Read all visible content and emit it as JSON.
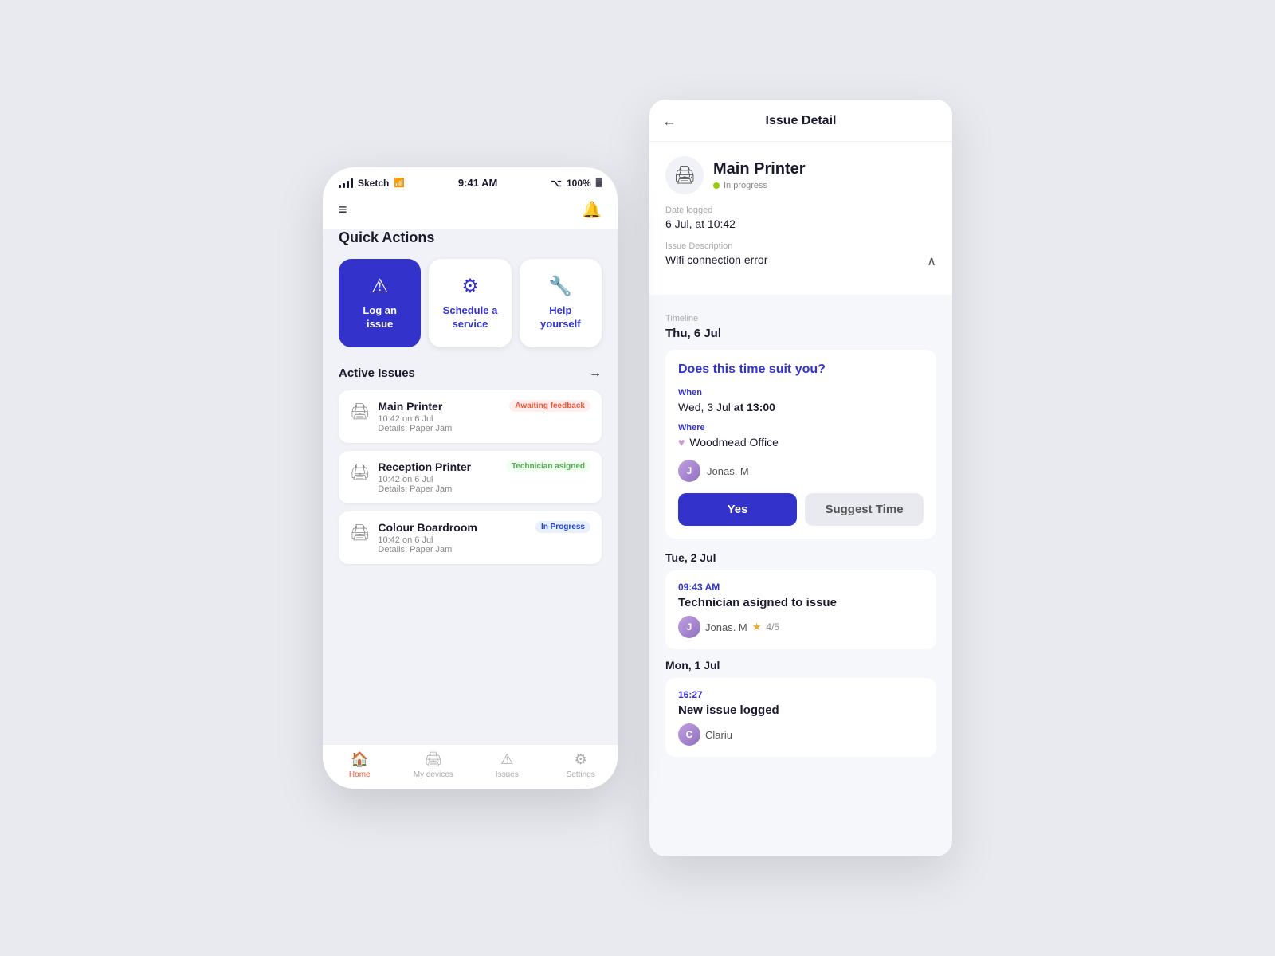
{
  "phone": {
    "status": {
      "carrier": "Sketch",
      "time": "9:41 AM",
      "battery": "100%"
    },
    "header": {
      "menu_icon": "☰",
      "bell_icon": "🔔"
    },
    "quick_actions": {
      "title": "Quick Actions",
      "items": [
        {
          "id": "log",
          "label": "Log an issue",
          "icon": "⚠",
          "type": "primary"
        },
        {
          "id": "schedule",
          "label": "Schedule a service",
          "icon": "⚙",
          "type": "secondary"
        },
        {
          "id": "help",
          "label": "Help yourself",
          "icon": "🔧",
          "type": "secondary"
        }
      ]
    },
    "active_issues": {
      "title": "Active Issues",
      "arrow": "→",
      "items": [
        {
          "name": "Main Printer",
          "time": "10:42 on 6 Jul",
          "details": "Details: Paper Jam",
          "badge": "Awaiting feedback",
          "badge_type": "red",
          "icon": "🖨"
        },
        {
          "name": "Reception Printer",
          "time": "10:42 on 6 Jul",
          "details": "Details: Paper Jam",
          "badge": "Technician asigned",
          "badge_type": "green",
          "icon": "🖨"
        },
        {
          "name": "Colour Boardroom",
          "time": "10:42 on 6 Jul",
          "details": "Details: Paper Jam",
          "badge": "In Progress",
          "badge_type": "blue",
          "icon": "🖨"
        }
      ]
    },
    "nav": {
      "items": [
        {
          "id": "home",
          "label": "Home",
          "icon": "🏠",
          "active": true
        },
        {
          "id": "devices",
          "label": "My devices",
          "icon": "🖨",
          "active": false
        },
        {
          "id": "issues",
          "label": "Issues",
          "icon": "⚠",
          "active": false
        },
        {
          "id": "settings",
          "label": "Settings",
          "icon": "⚙",
          "active": false
        }
      ]
    }
  },
  "detail": {
    "header": {
      "back_icon": "←",
      "title": "Issue Detail"
    },
    "device": {
      "name": "Main Printer",
      "status": "In progress",
      "icon": "🖨"
    },
    "date_logged": {
      "label": "Date logged",
      "value": "6 Jul, at 10:42"
    },
    "description": {
      "label": "Issue Description",
      "value": "Wifi connection error"
    },
    "timeline": {
      "label": "Timeline",
      "sections": [
        {
          "date": "Thu, 6 Jul",
          "events": [
            {
              "type": "time_suit",
              "question": "Does this time suit you?",
              "when_label": "When",
              "when_value_pre": "Wed, 3 Jul",
              "when_value_post": "at 13:00",
              "where_label": "Where",
              "where_value": "Woodmead Office",
              "assignee": "Jonas. M",
              "btn_yes": "Yes",
              "btn_suggest": "Suggest Time"
            }
          ]
        },
        {
          "date": "Tue, 2 Jul",
          "events": [
            {
              "type": "event",
              "time": "09:43 AM",
              "title": "Technician asigned to issue",
              "assignee": "Jonas. M",
              "rating": "4/5"
            }
          ]
        },
        {
          "date": "Mon, 1 Jul",
          "events": [
            {
              "type": "event",
              "time": "16:27",
              "title": "New issue logged",
              "assignee": "Clariu"
            }
          ]
        }
      ]
    }
  }
}
